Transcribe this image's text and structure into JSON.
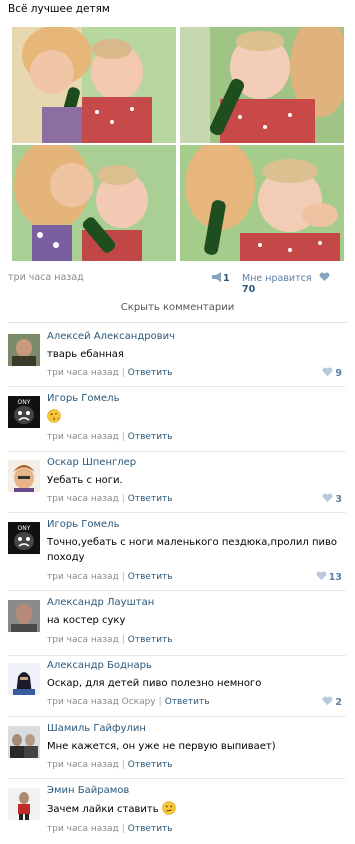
{
  "post": {
    "title": "Всё лучшее детям",
    "time": "три часа назад",
    "reposts": "1",
    "like_label": "Мне нравится",
    "likes": "70",
    "hide_comments": "Скрыть комментарии"
  },
  "comments": [
    {
      "name": "Алексей Александрович",
      "text": "тварь ебанная",
      "time": "три часа назад",
      "reply": "Ответить",
      "likes": "9"
    },
    {
      "name": "Игорь Гомель",
      "text": "",
      "time": "три часа назад",
      "reply": "Ответить",
      "likes": ""
    },
    {
      "name": "Оскар Шпенглер",
      "text": "Уебать с ноги.",
      "time": "три часа назад",
      "reply": "Ответить",
      "likes": "3"
    },
    {
      "name": "Игорь Гомель",
      "text": "Точно,уебать с ноги маленького пездюка,пролил пиво походу",
      "time": "три часа назад",
      "reply": "Ответить",
      "likes": "13"
    },
    {
      "name": "Александр Лауштан",
      "text": "на костер суку",
      "time": "три часа назад",
      "reply": "Ответить",
      "likes": ""
    },
    {
      "name": "Александр Боднарь",
      "text": "Оскар, для детей пиво полезно немного",
      "time": "три часа назад Оскару",
      "reply": "Ответить",
      "likes": "2"
    },
    {
      "name": "Шамиль Гайфулин",
      "text": "Мне кажется, он уже не первую выпивает)",
      "time": "три часа назад",
      "reply": "Ответить",
      "likes": ""
    },
    {
      "name": "Эмин Байрамов",
      "text": "Зачем лайки ставить",
      "time": "три часа назад",
      "reply": "Ответить",
      "likes": ""
    }
  ],
  "colors": {
    "link": "#2b587a",
    "muted": "#8a8a8a",
    "heart": "#8aa4c0"
  },
  "icons": [
    "megaphone-icon",
    "heart-icon",
    "kiss-emoji-icon",
    "confused-emoji-icon"
  ]
}
